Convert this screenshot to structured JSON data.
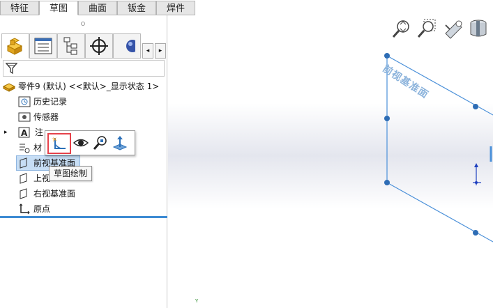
{
  "tabs": [
    {
      "label": "特征",
      "active": false
    },
    {
      "label": "草图",
      "active": true
    },
    {
      "label": "曲面",
      "active": false
    },
    {
      "label": "钣金",
      "active": false
    },
    {
      "label": "焊件",
      "active": false
    }
  ],
  "panel": {
    "panel_tabs": [
      "feature-manager",
      "property-manager",
      "configuration-manager",
      "dim-xpert-manager",
      "display-manager"
    ],
    "tree": {
      "root": "零件9 (默认) <<默认>_显示状态 1>",
      "items": [
        {
          "label": "历史记录"
        },
        {
          "label": "传感器"
        },
        {
          "label": "注"
        },
        {
          "label": "材"
        },
        {
          "label": "前视基准面"
        },
        {
          "label": "上视"
        },
        {
          "label": "右视基准面"
        },
        {
          "label": "原点"
        }
      ]
    }
  },
  "context_toolbar": {
    "tooltip": "草图绘制"
  },
  "viewport": {
    "plane_label": "前视基准面",
    "axis_label": "Y"
  },
  "colors": {
    "plane_edge": "#4a90d9",
    "selection": "#c7def5",
    "highlight_border": "#e6424b"
  }
}
